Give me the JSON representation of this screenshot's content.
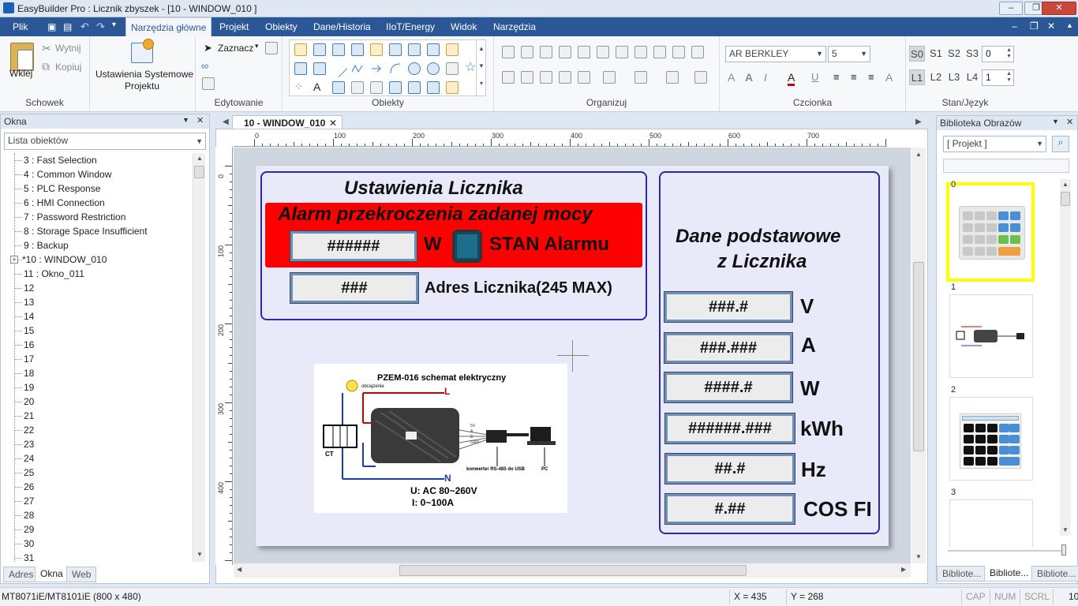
{
  "window": {
    "title": "EasyBuilder Pro : Licznik zbyszek - [10 - WINDOW_010 ]",
    "buttons": [
      "–",
      "❐",
      "✕"
    ]
  },
  "menu": {
    "items": [
      "Plik",
      "Narzędzia główne",
      "Projekt",
      "Obiekty",
      "Dane/Historia",
      "IIoT/Energy",
      "Widok",
      "Narzędzia"
    ],
    "active": "Narzędzia główne",
    "right_icons": [
      "–",
      "❐",
      "✕",
      "▲"
    ]
  },
  "ribbon": {
    "clipboard": {
      "label": "Schowek",
      "paste": "Wklej",
      "cut": "Wytnij",
      "copy": "Kopiuj"
    },
    "system": {
      "label1": "Ustawienia Systemowe",
      "label2": "Projektu"
    },
    "edit": {
      "label": "Edytowanie",
      "select": "Zaznacz"
    },
    "objects": {
      "label": "Obiekty"
    },
    "arrange": {
      "label": "Organizuj"
    },
    "font": {
      "label": "Czcionka",
      "family": "AR BERKLEY",
      "size": "5"
    },
    "state": {
      "label": "Stan/Język",
      "states": [
        "S0",
        "S1",
        "S2",
        "S3"
      ],
      "state_value": "0",
      "langs": [
        "L1",
        "L2",
        "L3",
        "L4"
      ],
      "lang_value": "1"
    }
  },
  "left_panel": {
    "title": "Okna",
    "dropdown": "Lista obiektów",
    "items": [
      "3 : Fast Selection",
      "4 : Common Window",
      "5 : PLC Response",
      "6 : HMI Connection",
      "7 : Password Restriction",
      "8 : Storage Space Insufficient",
      "9 : Backup",
      "*10 : WINDOW_010",
      "11 : Okno_011",
      "12",
      "13",
      "14",
      "15",
      "16",
      "17",
      "18",
      "19",
      "20",
      "21",
      "22",
      "23",
      "24",
      "25",
      "26",
      "27",
      "28",
      "29",
      "30",
      "31"
    ],
    "tabs": [
      "Adres",
      "Okna",
      "Web"
    ],
    "active_tab": "Okna"
  },
  "doc_tab": {
    "label": "10 - WINDOW_010",
    "close": "✕"
  },
  "ruler": {
    "h_labels": [
      "0",
      "100",
      "200",
      "300",
      "400",
      "500",
      "600",
      "700"
    ],
    "v_labels": [
      "0",
      "100",
      "200",
      "300",
      "400"
    ]
  },
  "hmi": {
    "title": "Ustawienia Licznika",
    "alarm_banner": "Alarm przekroczenia zadanej mocy",
    "alarm_display": "######",
    "alarm_unit": "W",
    "alarm_state": "STAN Alarmu",
    "address_display": "###",
    "address_label": "Adres Licznika(245 MAX)",
    "data_title_1": "Dane podstawowe",
    "data_title_2": "z Licznika",
    "readings": [
      {
        "value": "###.#",
        "unit": "V"
      },
      {
        "value": "###.###",
        "unit": "A"
      },
      {
        "value": "####.#",
        "unit": "W"
      },
      {
        "value": "######.###",
        "unit": "kWh"
      },
      {
        "value": "##.#",
        "unit": "Hz"
      },
      {
        "value": "#.##",
        "unit": "COS FI"
      }
    ],
    "diagram": {
      "title": "PZEM-016  schemat elektryczny",
      "load": "obciążenie",
      "L": "L",
      "N": "N",
      "ct": "CT",
      "voltage": "U: AC  80~260V",
      "current": "I:  0~100A",
      "converter": "konwerter RS-485 do USB",
      "pc": "PC",
      "pins": [
        "5V",
        "A",
        "B",
        "GND"
      ]
    }
  },
  "library": {
    "title": "Biblioteka Obrazów",
    "dropdown": "[ Projekt ]",
    "thumbs": [
      "0",
      "1",
      "2",
      "3"
    ],
    "tabs": [
      "Bibliote...",
      "Bibliote...",
      "Bibliote..."
    ],
    "active_tab_index": 1
  },
  "status": {
    "model": "MT8071iE/MT8101iE (800 x 480)",
    "x": "X = 435",
    "y": "Y = 268",
    "caps": "CAP",
    "num": "NUM",
    "scrl": "SCRL",
    "extra": "10"
  },
  "colors": {
    "menu_bar": "#2b5797",
    "alarm_red": "#ff0000",
    "frame_blue": "#2a2aa6",
    "page_bg": "#e8eafa",
    "library_selected": "#ffff00"
  }
}
